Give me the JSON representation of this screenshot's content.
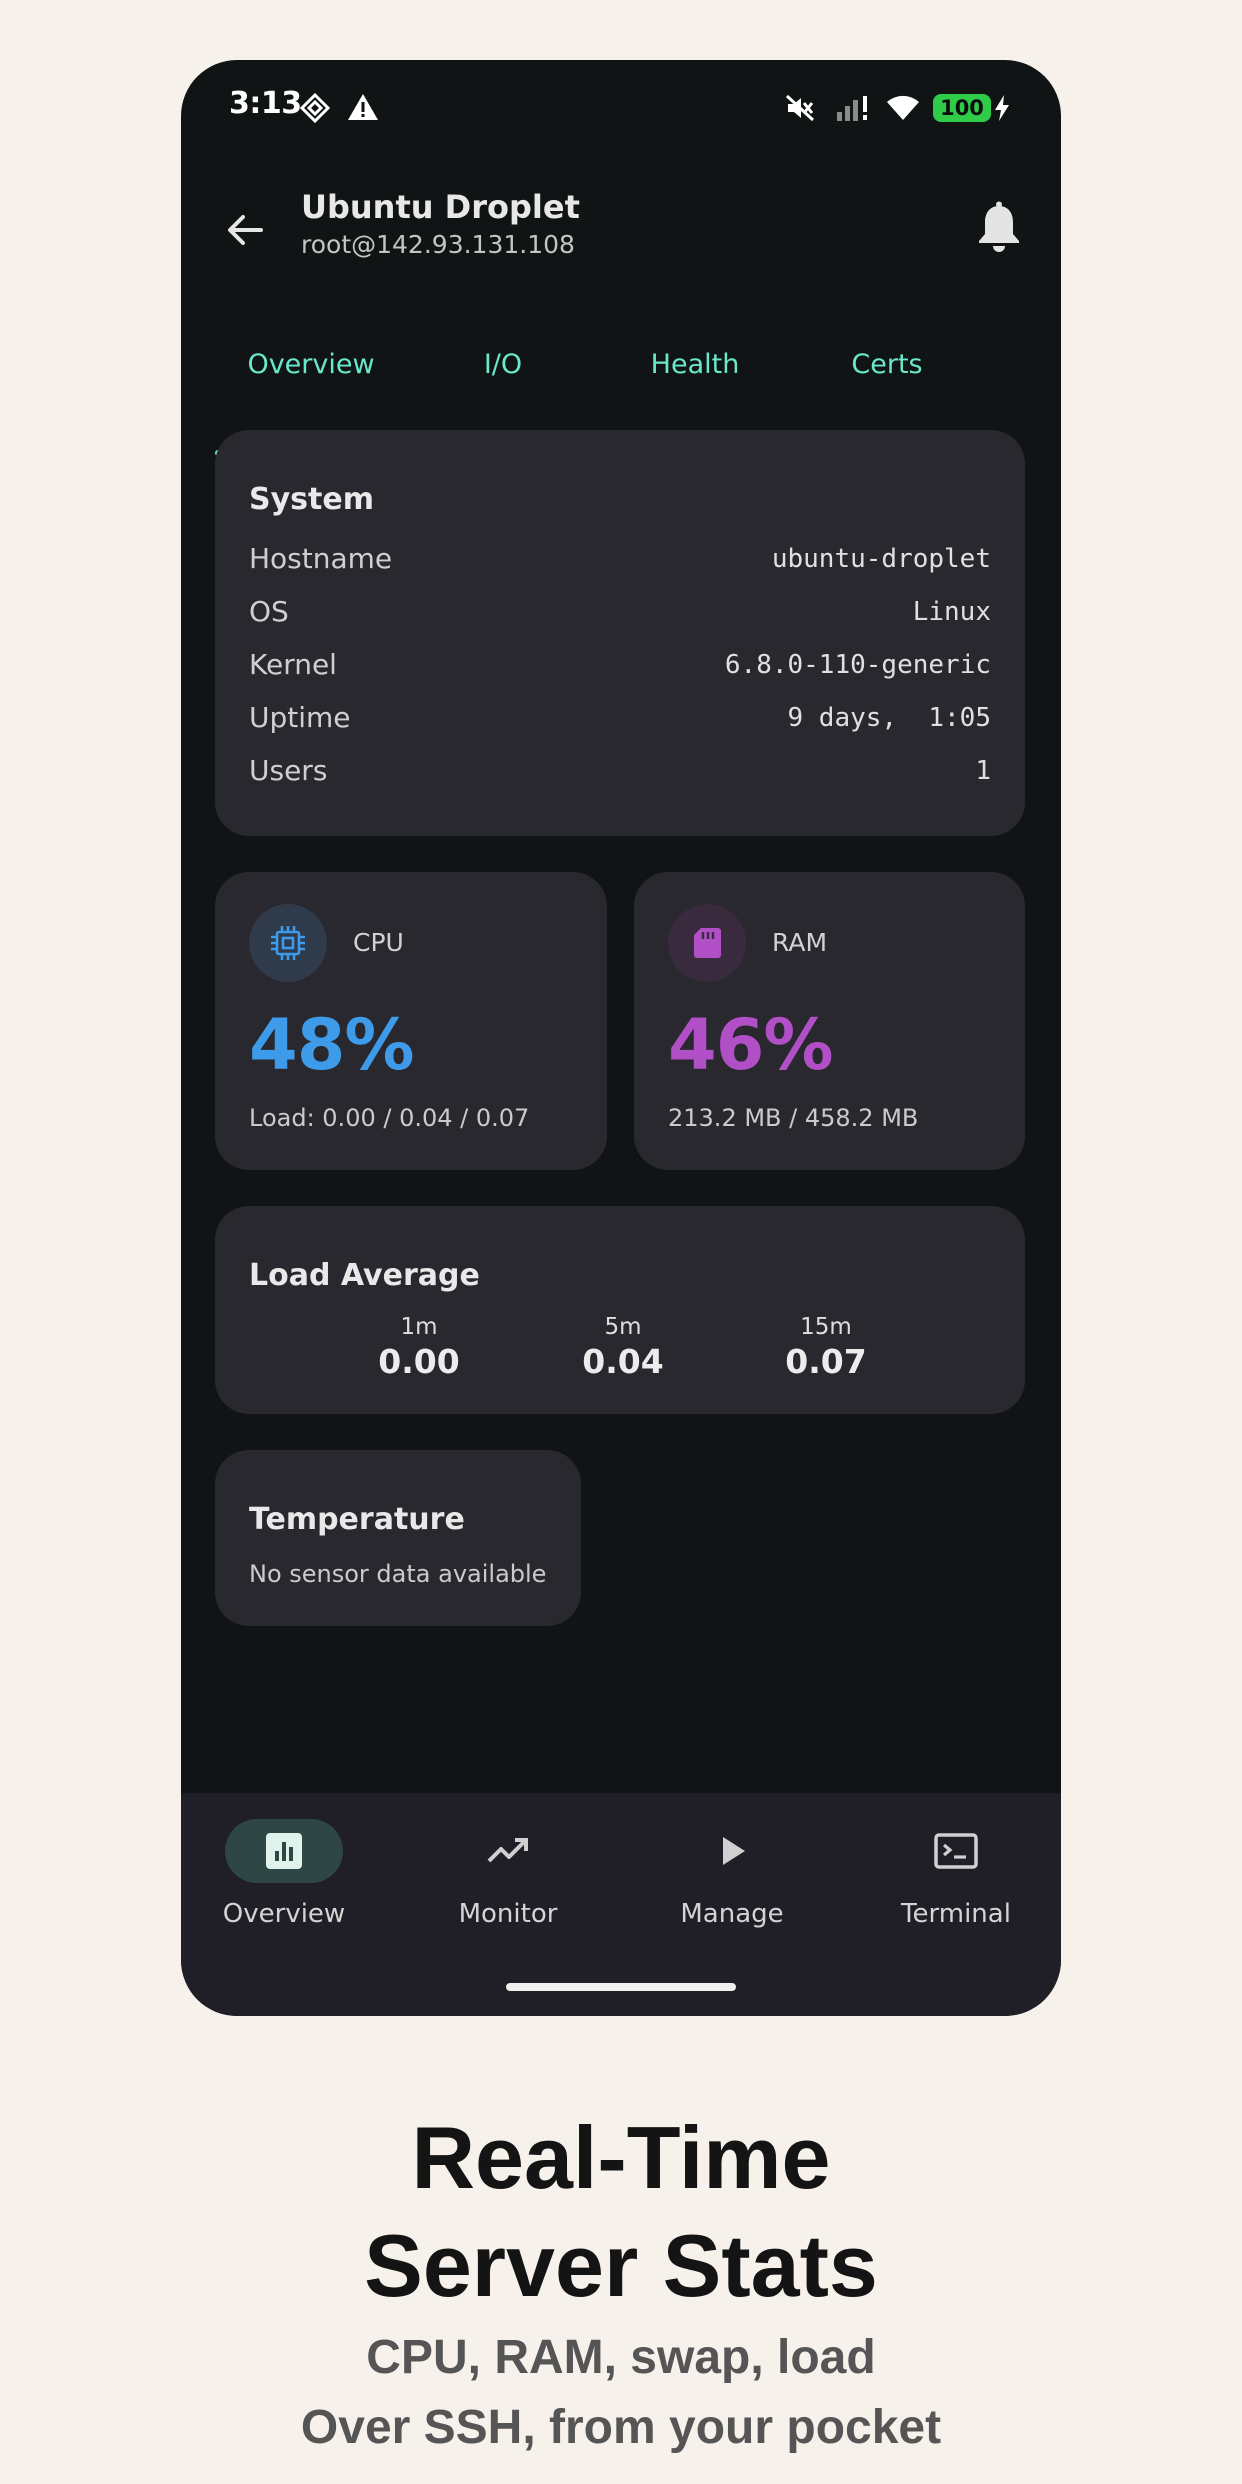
{
  "status_bar": {
    "time": "3:13",
    "battery": "100",
    "icons": [
      "diamond-icon",
      "warning-icon",
      "mute-icon",
      "signal-icon",
      "wifi-icon",
      "battery-icon",
      "charging-icon"
    ]
  },
  "header": {
    "title": "Ubuntu Droplet",
    "subtitle": "root@142.93.131.108",
    "back_icon": "arrow-back-icon",
    "bell_icon": "bell-icon"
  },
  "tabs": [
    {
      "label": "Overview",
      "active": true
    },
    {
      "label": "I/O",
      "active": false
    },
    {
      "label": "Health",
      "active": false
    },
    {
      "label": "Certs",
      "active": false
    }
  ],
  "system": {
    "title": "System",
    "rows": [
      {
        "label": "Hostname",
        "value": "ubuntu-droplet"
      },
      {
        "label": "OS",
        "value": "Linux"
      },
      {
        "label": "Kernel",
        "value": "6.8.0-110-generic"
      },
      {
        "label": "Uptime",
        "value": "9 days,  1:05"
      },
      {
        "label": "Users",
        "value": "1"
      }
    ]
  },
  "cpu": {
    "label": "CPU",
    "value": "48%",
    "sub": "Load: 0.00 / 0.04 / 0.07",
    "color": "#3d9be9",
    "icon": "cpu-chip-icon"
  },
  "ram": {
    "label": "RAM",
    "value": "46%",
    "sub": "213.2 MB / 458.2 MB",
    "color": "#b04fc6",
    "icon": "memory-card-icon"
  },
  "load_average": {
    "title": "Load Average",
    "items": [
      {
        "key": "1m",
        "value": "0.00"
      },
      {
        "key": "5m",
        "value": "0.04"
      },
      {
        "key": "15m",
        "value": "0.07"
      }
    ]
  },
  "temperature": {
    "title": "Temperature",
    "message": "No sensor data available"
  },
  "bottom_nav": [
    {
      "label": "Overview",
      "icon": "bar-chart-icon",
      "active": true
    },
    {
      "label": "Monitor",
      "icon": "trending-up-icon",
      "active": false
    },
    {
      "label": "Manage",
      "icon": "play-icon",
      "active": false
    },
    {
      "label": "Terminal",
      "icon": "terminal-icon",
      "active": false
    }
  ],
  "promo": {
    "title_line1": "Real-Time",
    "title_line2": "Server Stats",
    "subtitle_line1": "CPU, RAM, swap, load",
    "subtitle_line2": "Over SSH, from your pocket"
  },
  "colors": {
    "accent": "#69e8cc",
    "background": "#111414",
    "card": "#29282e",
    "page": "#f6f1ea"
  }
}
